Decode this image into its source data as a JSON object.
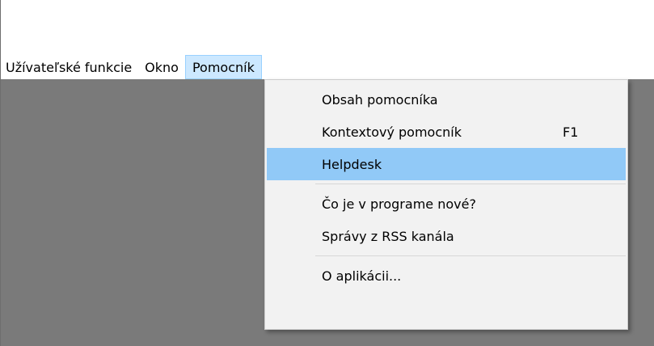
{
  "menubar": {
    "items": [
      {
        "label": "Užívateľské funkcie"
      },
      {
        "label": "Okno"
      },
      {
        "label": "Pomocník"
      }
    ]
  },
  "help_menu": {
    "items": [
      {
        "label": "Obsah pomocníka",
        "shortcut": ""
      },
      {
        "label": "Kontextový pomocník",
        "shortcut": "F1"
      },
      {
        "label": "Helpdesk",
        "shortcut": ""
      },
      {
        "label": "Čo je v programe nové?",
        "shortcut": ""
      },
      {
        "label": "Správy z RSS kanála",
        "shortcut": ""
      },
      {
        "label": "O aplikácii...",
        "shortcut": ""
      }
    ],
    "highlighted": "Helpdesk"
  },
  "colors": {
    "menubar_active_bg": "#cce8ff",
    "menu_highlight_bg": "#91c9f7",
    "workspace_bg": "#7a7a7a"
  }
}
